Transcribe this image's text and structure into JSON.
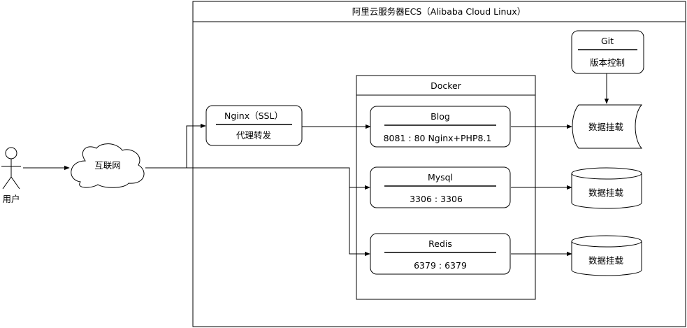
{
  "server": {
    "title": "阿里云服务器ECS（Alibaba Cloud Linux）"
  },
  "user": {
    "label": "用户"
  },
  "internet": {
    "label": "互联网"
  },
  "nginx": {
    "title": "Nginx（SSL）",
    "subtitle": "代理转发"
  },
  "docker": {
    "title": "Docker"
  },
  "blog": {
    "title": "Blog",
    "subtitle": "8081 : 80 Nginx+PHP8.1"
  },
  "mysql": {
    "title": "Mysql",
    "subtitle": "3306 : 3306"
  },
  "redis": {
    "title": "Redis",
    "subtitle": "6379 : 6379"
  },
  "git": {
    "title": "Git",
    "subtitle": "版本控制"
  },
  "storage": {
    "blog": {
      "label": "数据挂载"
    },
    "mysql": {
      "label": "数据挂载"
    },
    "redis": {
      "label": "数据挂载"
    }
  }
}
